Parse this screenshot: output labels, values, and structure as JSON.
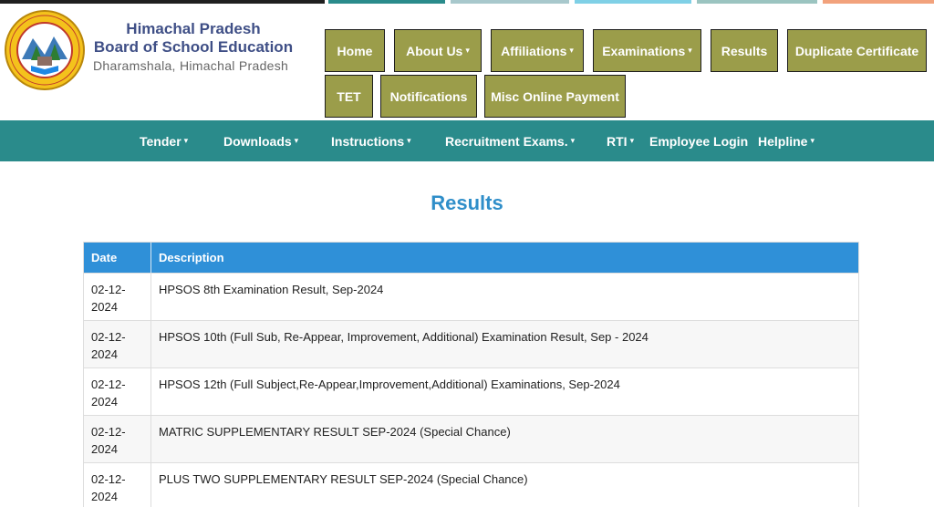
{
  "colors": {
    "accent_olive": "#9b9d4a",
    "subnav_teal": "#2a8b8b",
    "table_header_blue": "#2f90d8",
    "title_blue": "#2f8ec9",
    "top_strip": [
      "#1f1f1f",
      "#2a8b8b",
      "#a8c8cc",
      "#7fd0e6",
      "#9bc4c0",
      "#f2a27c"
    ]
  },
  "header": {
    "logo_icon": "board-seal-icon",
    "org_line1": "Himachal Pradesh",
    "org_line2": "Board of School Education",
    "org_line3": "Dharamshala, Himachal Pradesh"
  },
  "main_nav": {
    "home": "Home",
    "about": "About Us",
    "affiliations": "Affiliations",
    "examinations": "Examinations",
    "results": "Results",
    "duplicate": "Duplicate Certificate",
    "tet": "TET",
    "notifications": "Notifications",
    "misc_payment": "Misc Online Payment",
    "caret": "▾"
  },
  "sub_nav": {
    "tender": "Tender",
    "downloads": "Downloads",
    "instructions": "Instructions",
    "recruitment": "Recruitment Exams.",
    "rti": "RTI",
    "employee_login": "Employee Login",
    "helpline": "Helpline",
    "caret": "▾"
  },
  "page_title": "Results",
  "table": {
    "headers": {
      "date": "Date",
      "description": "Description"
    },
    "rows": [
      {
        "date_line1": "02-12-",
        "date_line2": "2024",
        "description": "HPSOS 8th Examination Result, Sep-2024"
      },
      {
        "date_line1": "02-12-",
        "date_line2": "2024",
        "description": "HPSOS 10th (Full Sub, Re-Appear, Improvement, Additional) Examination Result, Sep - 2024"
      },
      {
        "date_line1": "02-12-",
        "date_line2": "2024",
        "description": "HPSOS 12th (Full Subject,Re-Appear,Improvement,Additional) Examinations, Sep-2024"
      },
      {
        "date_line1": "02-12-",
        "date_line2": "2024",
        "description": "MATRIC SUPPLEMENTARY RESULT SEP-2024 (Special Chance)"
      },
      {
        "date_line1": "02-12-",
        "date_line2": "2024",
        "description": "PLUS TWO SUPPLEMENTARY RESULT SEP-2024 (Special Chance)"
      }
    ]
  }
}
